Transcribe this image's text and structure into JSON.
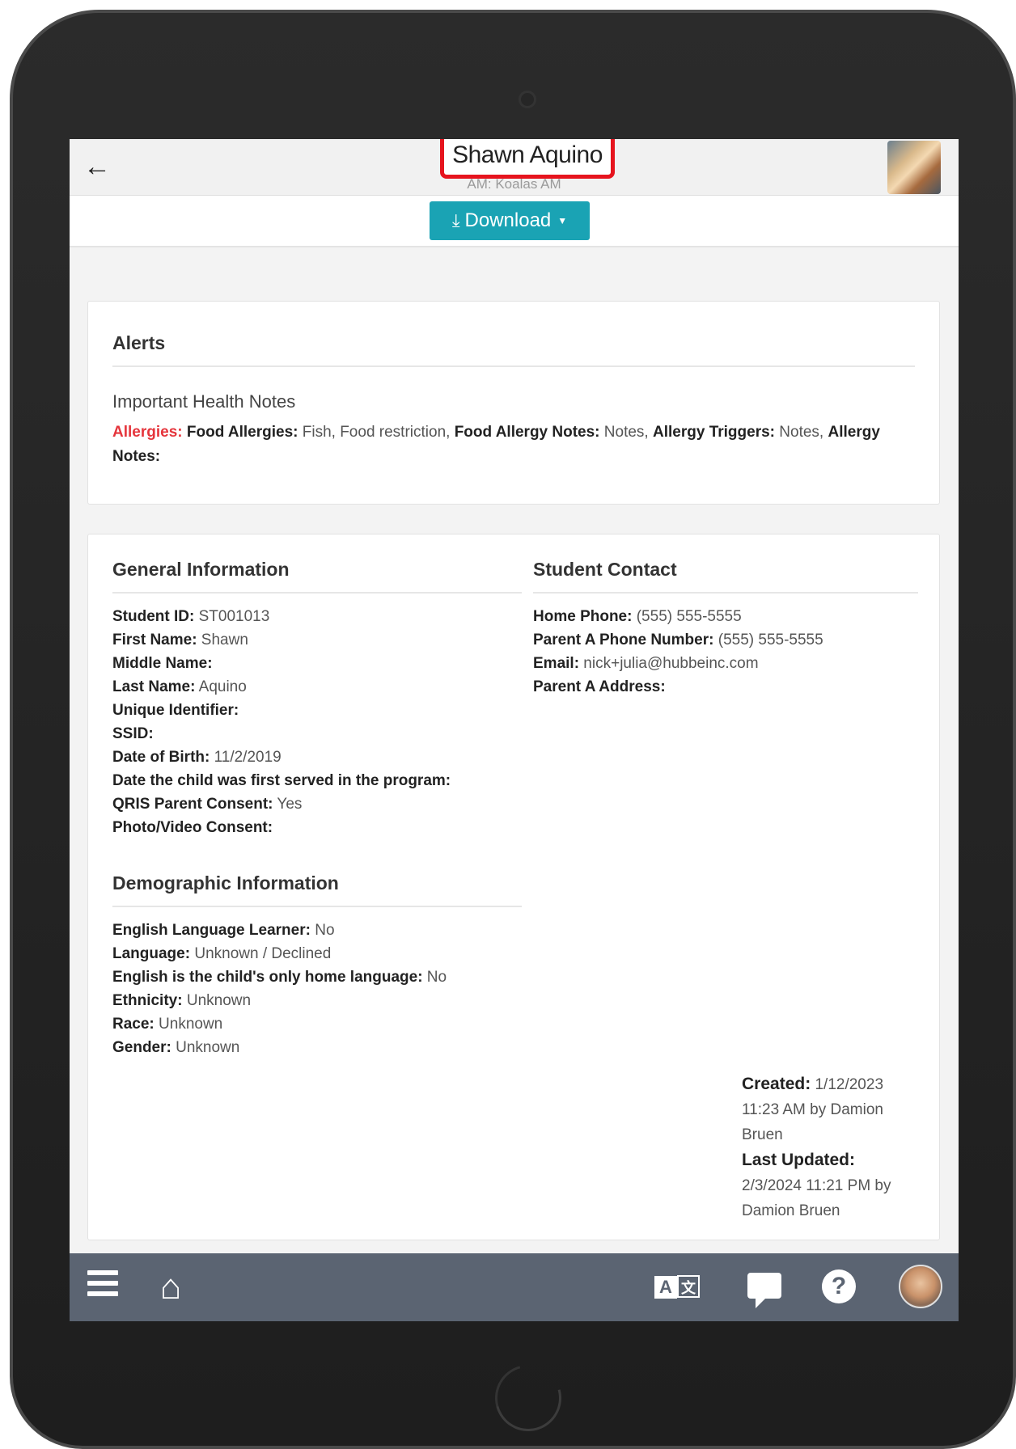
{
  "header": {
    "back_label": "←",
    "title": "Shawn Aquino",
    "subtitle": "AM: Koalas AM",
    "avatar_icon": "child-photo-avatar",
    "highlight_color": "#e6141e"
  },
  "toolbar": {
    "download_label": "Download",
    "download_icon": "download-icon",
    "accent_color": "#1aa3b4"
  },
  "alerts": {
    "title": "Alerts",
    "health_title": "Important Health Notes",
    "allergies_label": "Allergies:",
    "food_allergies_label": "Food Allergies:",
    "food_allergies_value": " Fish, Food restriction,",
    "food_allergy_notes_label": "Food Allergy Notes:",
    "food_allergy_notes_value": " Notes,",
    "allergy_triggers_label": "Allergy Triggers:",
    "allergy_triggers_value": " Notes,",
    "allergy_notes_label": "Allergy Notes:"
  },
  "general": {
    "title": "General Information",
    "fields": [
      {
        "label": "Student ID:",
        "value": " ST001013"
      },
      {
        "label": "First Name:",
        "value": " Shawn"
      },
      {
        "label": "Middle Name:",
        "value": ""
      },
      {
        "label": "Last Name:",
        "value": " Aquino"
      },
      {
        "label": "Unique Identifier:",
        "value": ""
      },
      {
        "label": "SSID:",
        "value": ""
      },
      {
        "label": "Date of Birth:",
        "value": " 11/2/2019"
      },
      {
        "label": "Date the child was first served in the program:",
        "value": ""
      },
      {
        "label": "QRIS Parent Consent:",
        "value": " Yes"
      },
      {
        "label": "Photo/Video Consent:",
        "value": ""
      }
    ]
  },
  "contact": {
    "title": "Student Contact",
    "fields": [
      {
        "label": "Home Phone:",
        "value": " (555) 555-5555"
      },
      {
        "label": "Parent A Phone Number:",
        "value": " (555) 555-5555"
      },
      {
        "label": "Email:",
        "value": " nick+julia@hubbeinc.com"
      },
      {
        "label": "Parent A Address:",
        "value": ""
      }
    ]
  },
  "demographic": {
    "title": "Demographic Information",
    "fields": [
      {
        "label": "English Language Learner:",
        "value": " No"
      },
      {
        "label": "Language:",
        "value": " Unknown / Declined"
      },
      {
        "label": "English is the child's only home language:",
        "value": " No"
      },
      {
        "label": "Ethnicity:",
        "value": " Unknown"
      },
      {
        "label": "Race:",
        "value": " Unknown"
      },
      {
        "label": "Gender:",
        "value": " Unknown"
      }
    ]
  },
  "meta": {
    "created_label": "Created:",
    "created_value": " 1/12/2023 11:23 AM by Damion Bruen",
    "updated_label": "Last Updated:",
    "updated_value": "2/3/2024 11:21 PM by Damion Bruen"
  },
  "bottom_nav": {
    "menu_icon": "hamburger-menu-icon",
    "home_icon": "home-icon",
    "translate_a": "A",
    "translate_z": "文",
    "chat_icon": "chat-bubble-icon",
    "help_label": "?",
    "profile_icon": "user-avatar",
    "bar_color": "#5b6472"
  }
}
